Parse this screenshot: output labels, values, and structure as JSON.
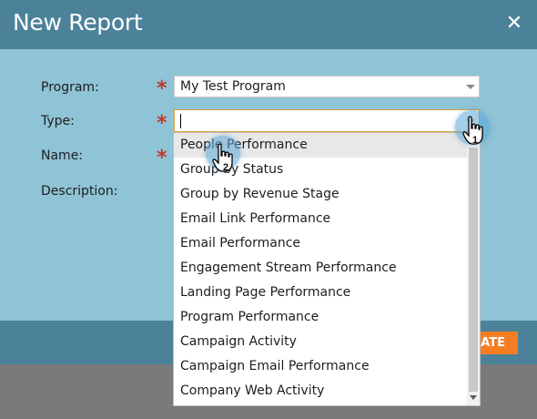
{
  "dialog": {
    "title": "New Report",
    "close_icon": "close-icon"
  },
  "form": {
    "program_label": "Program:",
    "type_label": "Type:",
    "name_label": "Name:",
    "description_label": "Description:",
    "required_marker": "*",
    "program_value": "My Test Program",
    "type_value": ""
  },
  "footer": {
    "create_label": "EATE"
  },
  "dropdown": {
    "options": [
      "People Performance",
      "Group by Status",
      "Group by Revenue Stage",
      "Email Link Performance",
      "Email Performance",
      "Engagement Stream Performance",
      "Landing Page Performance",
      "Program Performance",
      "Campaign Activity",
      "Campaign Email Performance",
      "Company Web Activity"
    ],
    "highlighted_index": 0
  },
  "annotations": {
    "step1": "1",
    "step2": "2"
  },
  "colors": {
    "header": "#4b8299",
    "body": "#8fc3d6",
    "accent": "#f47d24",
    "required": "#c0392b"
  }
}
